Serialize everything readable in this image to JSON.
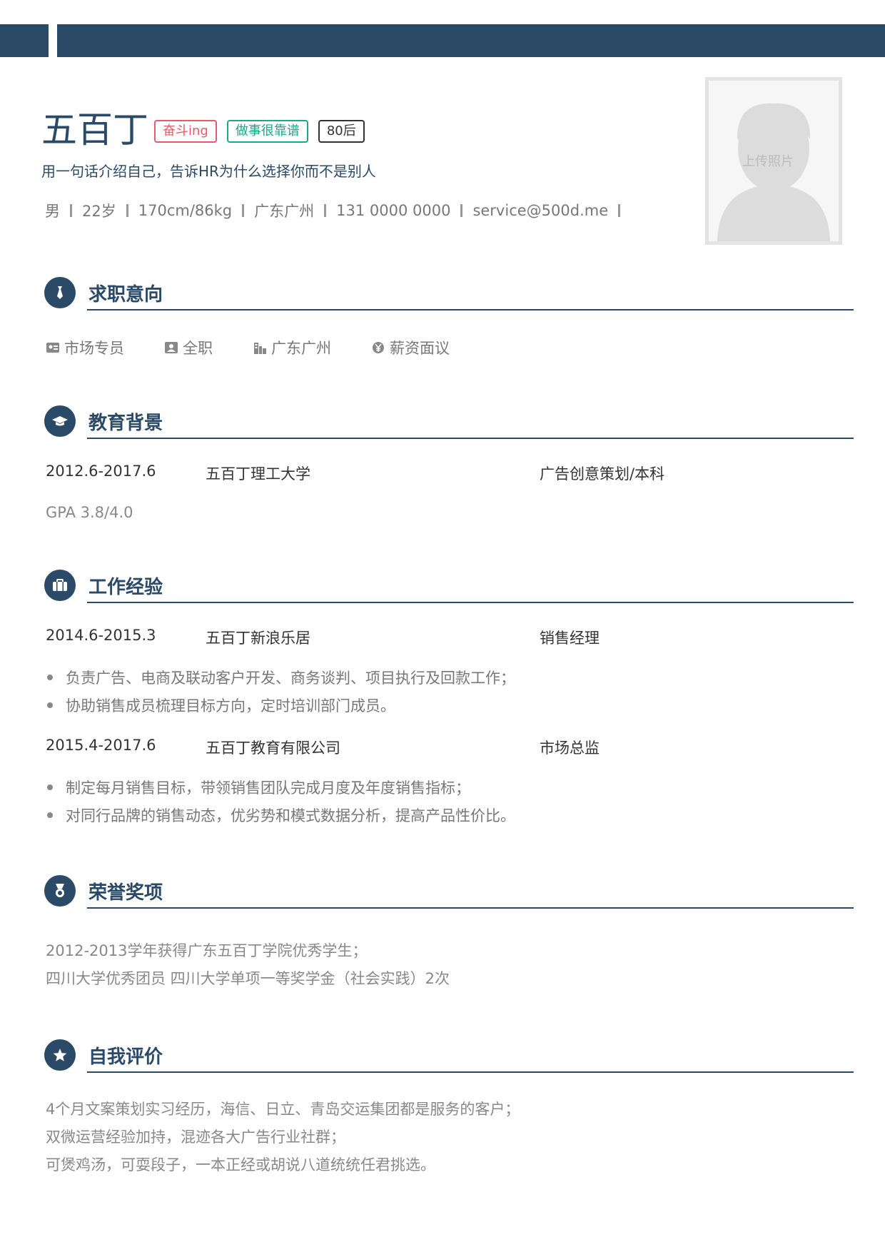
{
  "header": {
    "name": "五百丁",
    "tags": [
      "奋斗ing",
      "做事很靠谱",
      "80后"
    ],
    "tagline": "用一句话介绍自己，告诉HR为什么选择你而不是别人",
    "info": [
      "男",
      "22岁",
      "170cm/86kg",
      "广东广州",
      "131 0000 0000",
      "service@500d.me"
    ],
    "photo_label": "上传照片"
  },
  "intent": {
    "title": "求职意向",
    "items": [
      {
        "icon": "id-card-icon",
        "label": "市场专员"
      },
      {
        "icon": "contact-icon",
        "label": "全职"
      },
      {
        "icon": "building-icon",
        "label": "广东广州"
      },
      {
        "icon": "yen-icon",
        "label": "薪资面议"
      }
    ]
  },
  "education": {
    "title": "教育背景",
    "date": "2012.6-2017.6",
    "school": "五百丁理工大学",
    "major": "广告创意策划/本科",
    "gpa": "GPA 3.8/4.0"
  },
  "work": {
    "title": "工作经验",
    "jobs": [
      {
        "date": "2014.6-2015.3",
        "company": "五百丁新浪乐居",
        "role": "销售经理",
        "bullets": [
          "负责广告、电商及联动客户开发、商务谈判、项目执行及回款工作；",
          "协助销售成员梳理目标方向，定时培训部门成员。"
        ]
      },
      {
        "date": "2015.4-2017.6",
        "company": "五百丁教育有限公司",
        "role": "市场总监",
        "bullets": [
          "制定每月销售目标，带领销售团队完成月度及年度销售指标；",
          "对同行品牌的销售动态，优劣势和模式数据分析，提高产品性价比。"
        ]
      }
    ]
  },
  "honors": {
    "title": "荣誉奖项",
    "lines": [
      "2012-2013学年获得广东五百丁学院优秀学生；",
      "四川大学优秀团员 四川大学单项一等奖学金（社会实践）2次"
    ]
  },
  "self": {
    "title": "自我评价",
    "lines": [
      "4个月文案策划实习经历，海信、日立、青岛交运集团都是服务的客户；",
      "双微运营经验加持，混迹各大广告行业社群；",
      "可煲鸡汤，可耍段子，一本正经或胡说八道统统任君挑选。"
    ]
  },
  "colors": {
    "primary": "#2a4a68",
    "tag_red": "#e8596b",
    "tag_green": "#1aa888"
  }
}
